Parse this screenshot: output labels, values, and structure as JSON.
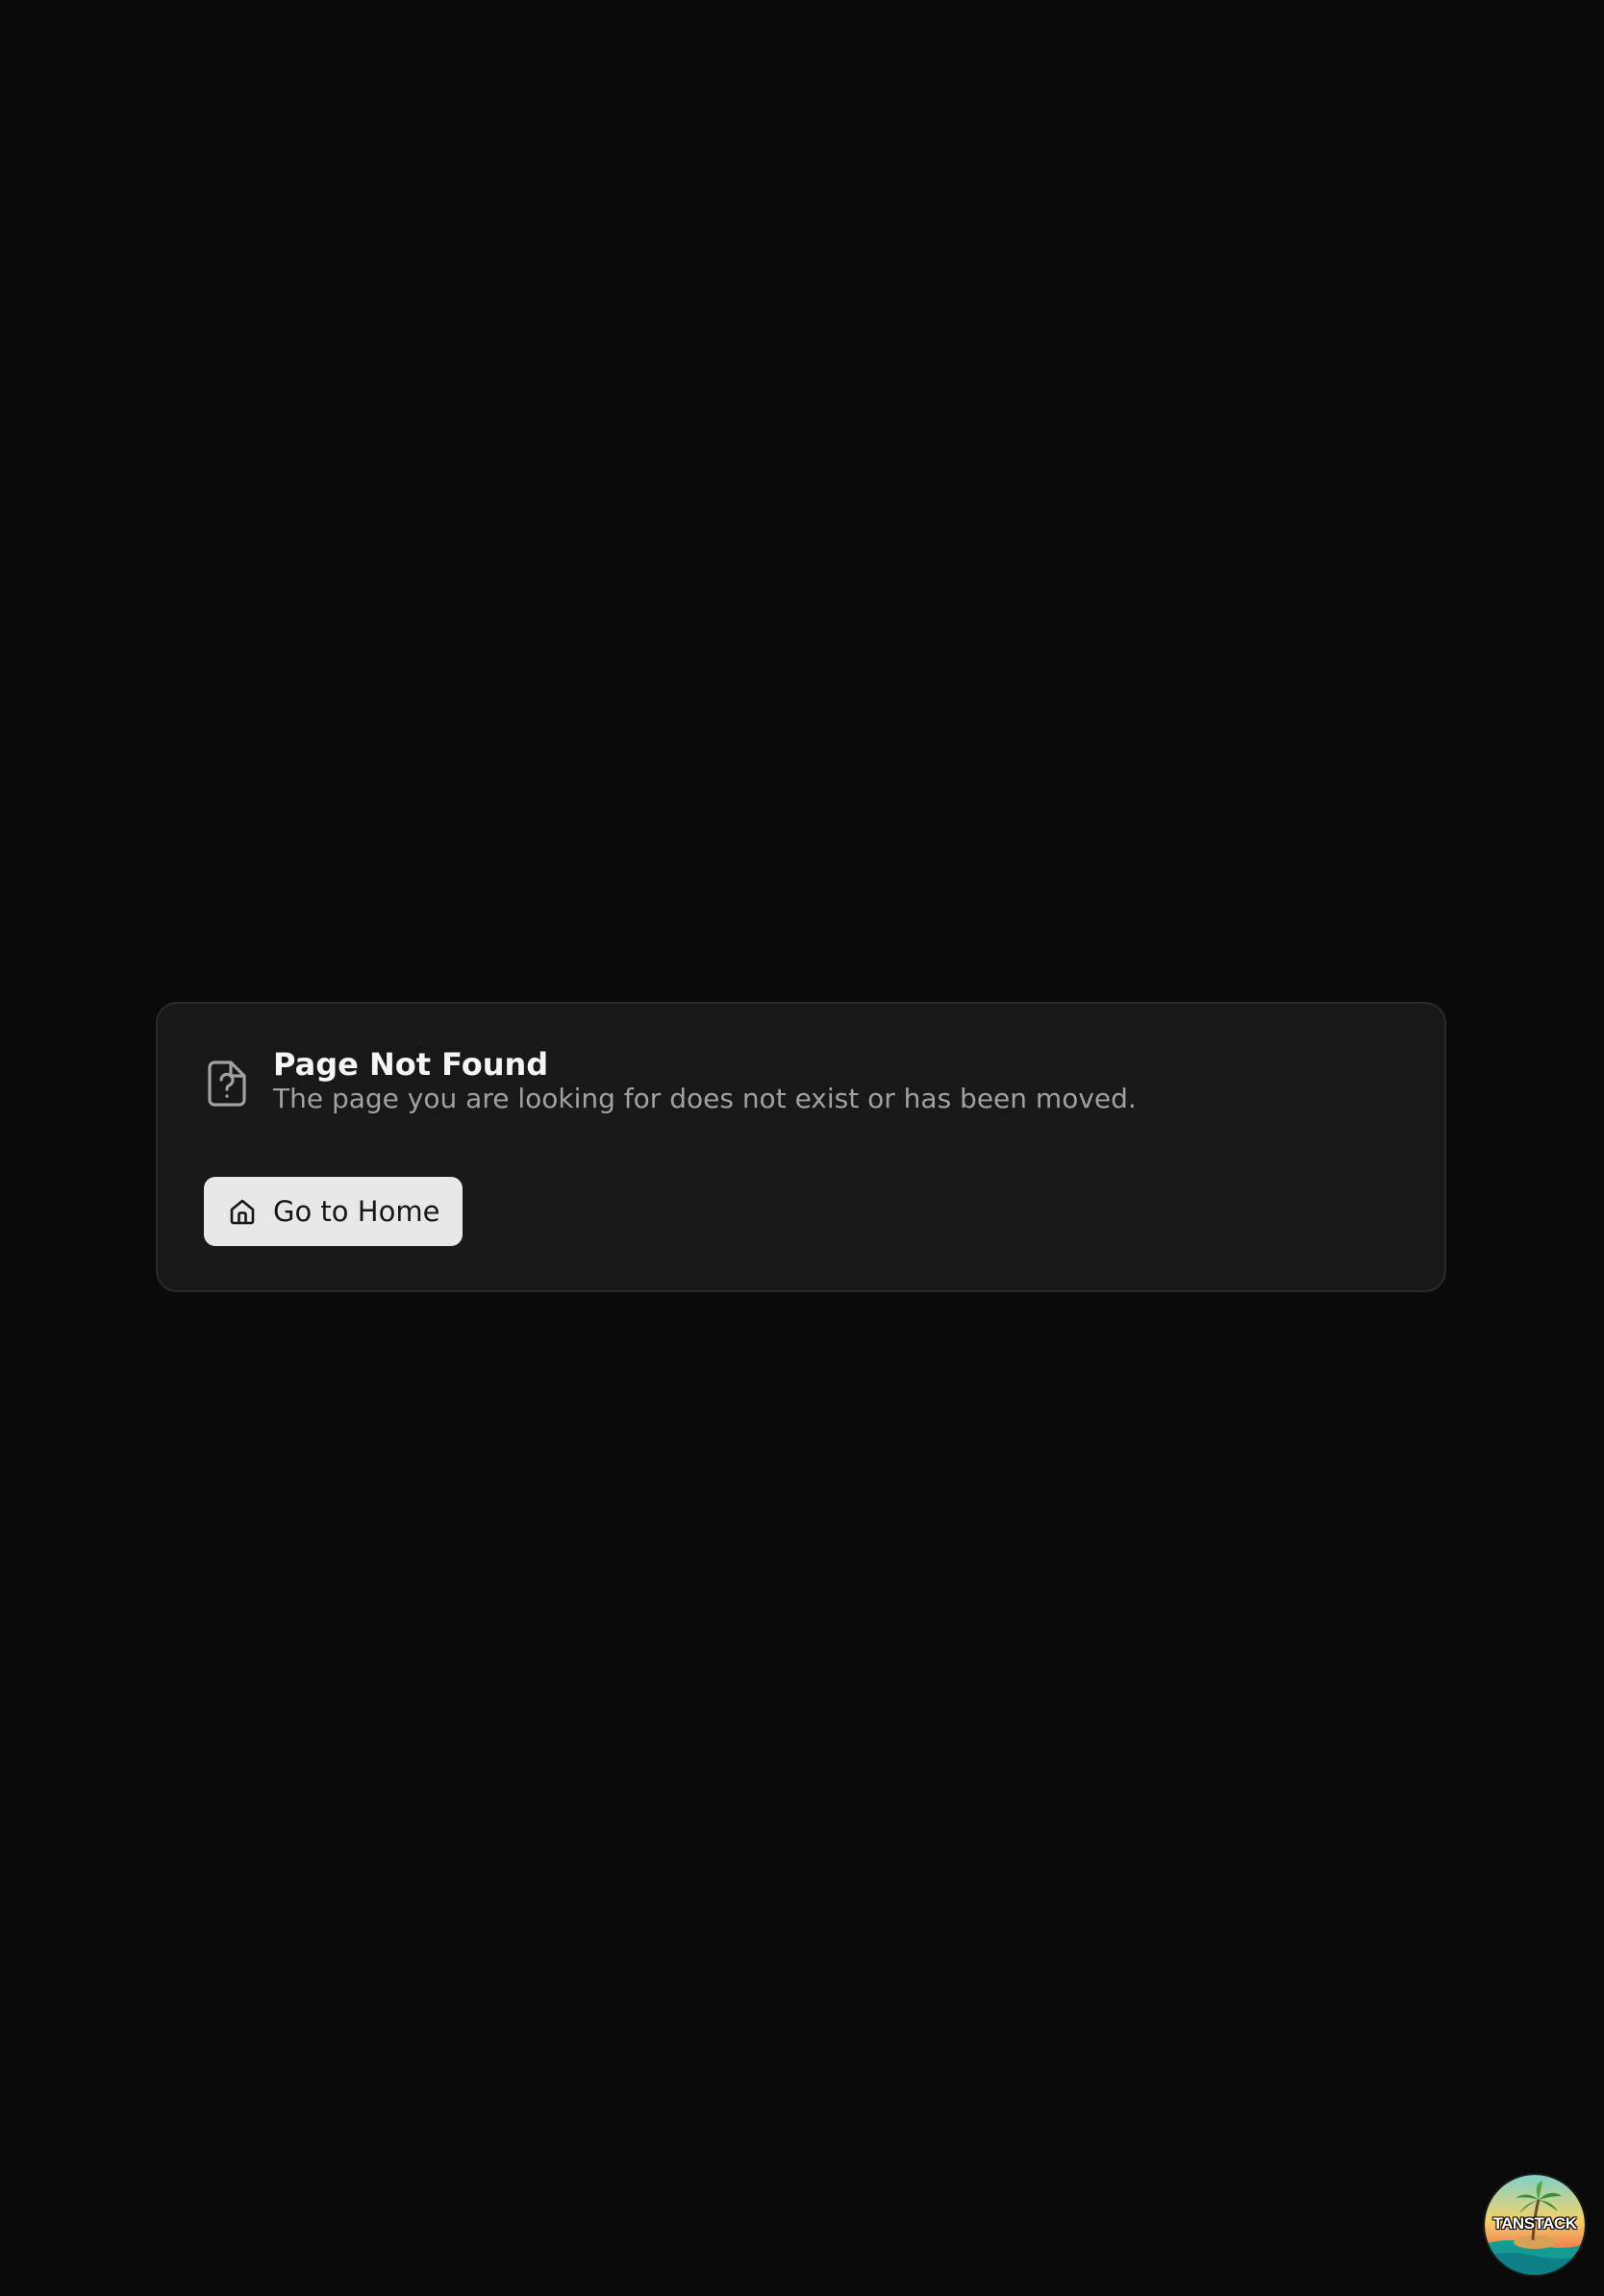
{
  "not_found": {
    "title": "Page Not Found",
    "message": "The page you are looking for does not exist or has been moved.",
    "home_button_label": "Go to Home"
  },
  "devtools": {
    "logo_text": "TANSTACK"
  },
  "icons": {
    "header": "file-question-icon",
    "button": "home-icon"
  },
  "colors": {
    "background": "#0a0a0a",
    "card_background": "#181818",
    "card_border": "#2a2a2a",
    "title": "#f5f5f5",
    "subtitle": "#a1a1a1",
    "button_background": "#e8e8e8",
    "button_text": "#171717"
  }
}
